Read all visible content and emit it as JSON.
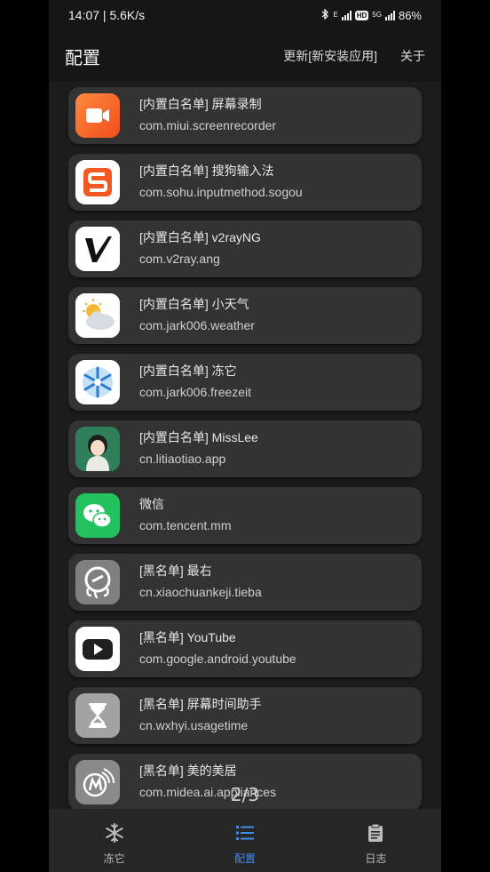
{
  "status": {
    "time_speed": "14:07 | 5.6K/s",
    "net_type": "E",
    "net5g": "5G",
    "battery": "86%"
  },
  "appbar": {
    "title": "配置",
    "update_label": "更新[新安装应用]",
    "about_label": "关于"
  },
  "apps": [
    {
      "name": "[内置白名单] 屏幕录制",
      "package": "com.miui.screenrecorder",
      "icon": "screen-recorder-icon"
    },
    {
      "name": "[内置白名单] 搜狗输入法",
      "package": "com.sohu.inputmethod.sogou",
      "icon": "sogou-icon"
    },
    {
      "name": "[内置白名单] v2rayNG",
      "package": "com.v2ray.ang",
      "icon": "v2ray-icon"
    },
    {
      "name": "[内置白名单] 小天气",
      "package": "com.jark006.weather",
      "icon": "weather-icon"
    },
    {
      "name": "[内置白名单] 冻它",
      "package": "com.jark006.freezeit",
      "icon": "snowflake-icon"
    },
    {
      "name": "[内置白名单] MissLee",
      "package": "cn.litiaotiao.app",
      "icon": "girl-avatar-icon"
    },
    {
      "name": "微信",
      "package": "com.tencent.mm",
      "icon": "wechat-icon"
    },
    {
      "name": "[黑名单] 最右",
      "package": "cn.xiaochuankeji.tieba",
      "icon": "zuiyou-icon"
    },
    {
      "name": "[黑名单] YouTube",
      "package": "com.google.android.youtube",
      "icon": "youtube-icon"
    },
    {
      "name": "[黑名单] 屏幕时间助手",
      "package": "cn.wxhyi.usagetime",
      "icon": "hourglass-icon"
    },
    {
      "name": "[黑名单] 美的美居",
      "package": "com.midea.ai.appliances",
      "icon": "midea-icon"
    }
  ],
  "pager": "2/3",
  "nav": {
    "freeze_label": "冻它",
    "config_label": "配置",
    "log_label": "日志"
  },
  "colors": {
    "accent": "#3d8ef0",
    "card": "#333333",
    "background": "#1c1c1c"
  }
}
